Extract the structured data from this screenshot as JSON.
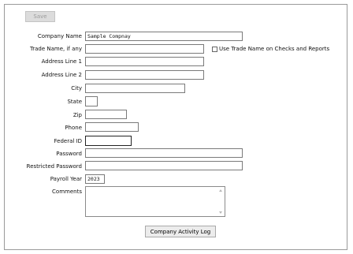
{
  "toolbar": {
    "save_label": "Save"
  },
  "form": {
    "company_name": {
      "label": "Company Name",
      "value": "Sample Compnay"
    },
    "trade_name": {
      "label": "Trade Name, if any",
      "value": ""
    },
    "use_trade_name": {
      "label": "Use Trade Name on Checks and Reports",
      "checked": false
    },
    "address1": {
      "label": "Address Line 1",
      "value": ""
    },
    "address2": {
      "label": "Address Line 2",
      "value": ""
    },
    "city": {
      "label": "City",
      "value": ""
    },
    "state": {
      "label": "State",
      "value": ""
    },
    "zip": {
      "label": "Zip",
      "value": ""
    },
    "phone": {
      "label": "Phone",
      "value": ""
    },
    "federal_id": {
      "label": "Federal ID",
      "value": ""
    },
    "password": {
      "label": "Password",
      "value": ""
    },
    "restricted_password": {
      "label": "Restricted Password",
      "value": ""
    },
    "payroll_year": {
      "label": "Payroll Year",
      "value": "2023"
    },
    "comments": {
      "label": "Comments",
      "value": ""
    }
  },
  "footer": {
    "activity_log_label": "Company Activity Log"
  },
  "icons": {
    "scroll_up": "scroll-up-arrow-icon",
    "scroll_down": "scroll-down-arrow-icon"
  }
}
